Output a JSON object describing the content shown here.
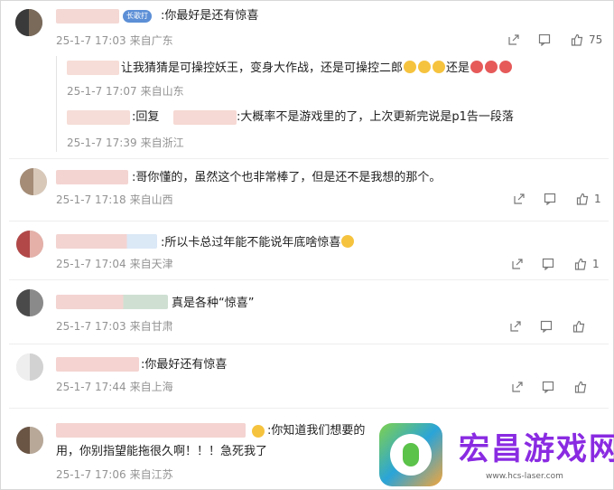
{
  "colors": {
    "meta": "#939393",
    "text": "#222222",
    "watermark": "#8a2be2",
    "badge": "#5c8fd6"
  },
  "comments": [
    {
      "type": "top",
      "badge": "长歌打",
      "text": ":你最好是还有惊喜",
      "time": "25-1-7 17:03",
      "place": "来自广东",
      "likes": "75"
    },
    {
      "type": "reply",
      "text_a": "让我猜猜是可操控妖王，变身大作战，还是可操控二郎",
      "text_b": "还是",
      "time": "25-1-7 17:07",
      "place": "来自山东"
    },
    {
      "type": "reply",
      "text": ":回复",
      "text2": ":大概率不是游戏里的了，上次更新完说是p1告一段落",
      "time": "25-1-7 17:39",
      "place": "来自浙江"
    },
    {
      "type": "top",
      "text": ":哥你懂的，虽然这个也非常棒了，但是还不是我想的那个。",
      "time": "25-1-7 17:18",
      "place": "来自山西",
      "likes": "1"
    },
    {
      "type": "top",
      "text": ":所以卡总过年能不能说年底啥惊喜",
      "time": "25-1-7 17:04",
      "place": "来自天津",
      "likes": "1"
    },
    {
      "type": "top",
      "text": "真是各种“惊喜”",
      "time": "25-1-7 17:03",
      "place": "来自甘肃",
      "likes": ""
    },
    {
      "type": "top",
      "text": ":你最好还有惊喜",
      "time": "25-1-7 17:44",
      "place": "来自上海",
      "likes": ""
    },
    {
      "type": "top",
      "text": ":你知道我们想要的",
      "text2": "用，你别指望能拖很久啊！！！急死我了",
      "time": "25-1-7 17:06",
      "place": "来自江苏",
      "likes": ""
    }
  ],
  "watermark": {
    "title": "宏昌游戏网",
    "url": "www.hcs-laser.com"
  },
  "icons": [
    "share-icon",
    "comment-icon",
    "like-icon",
    "emoji-icon"
  ]
}
